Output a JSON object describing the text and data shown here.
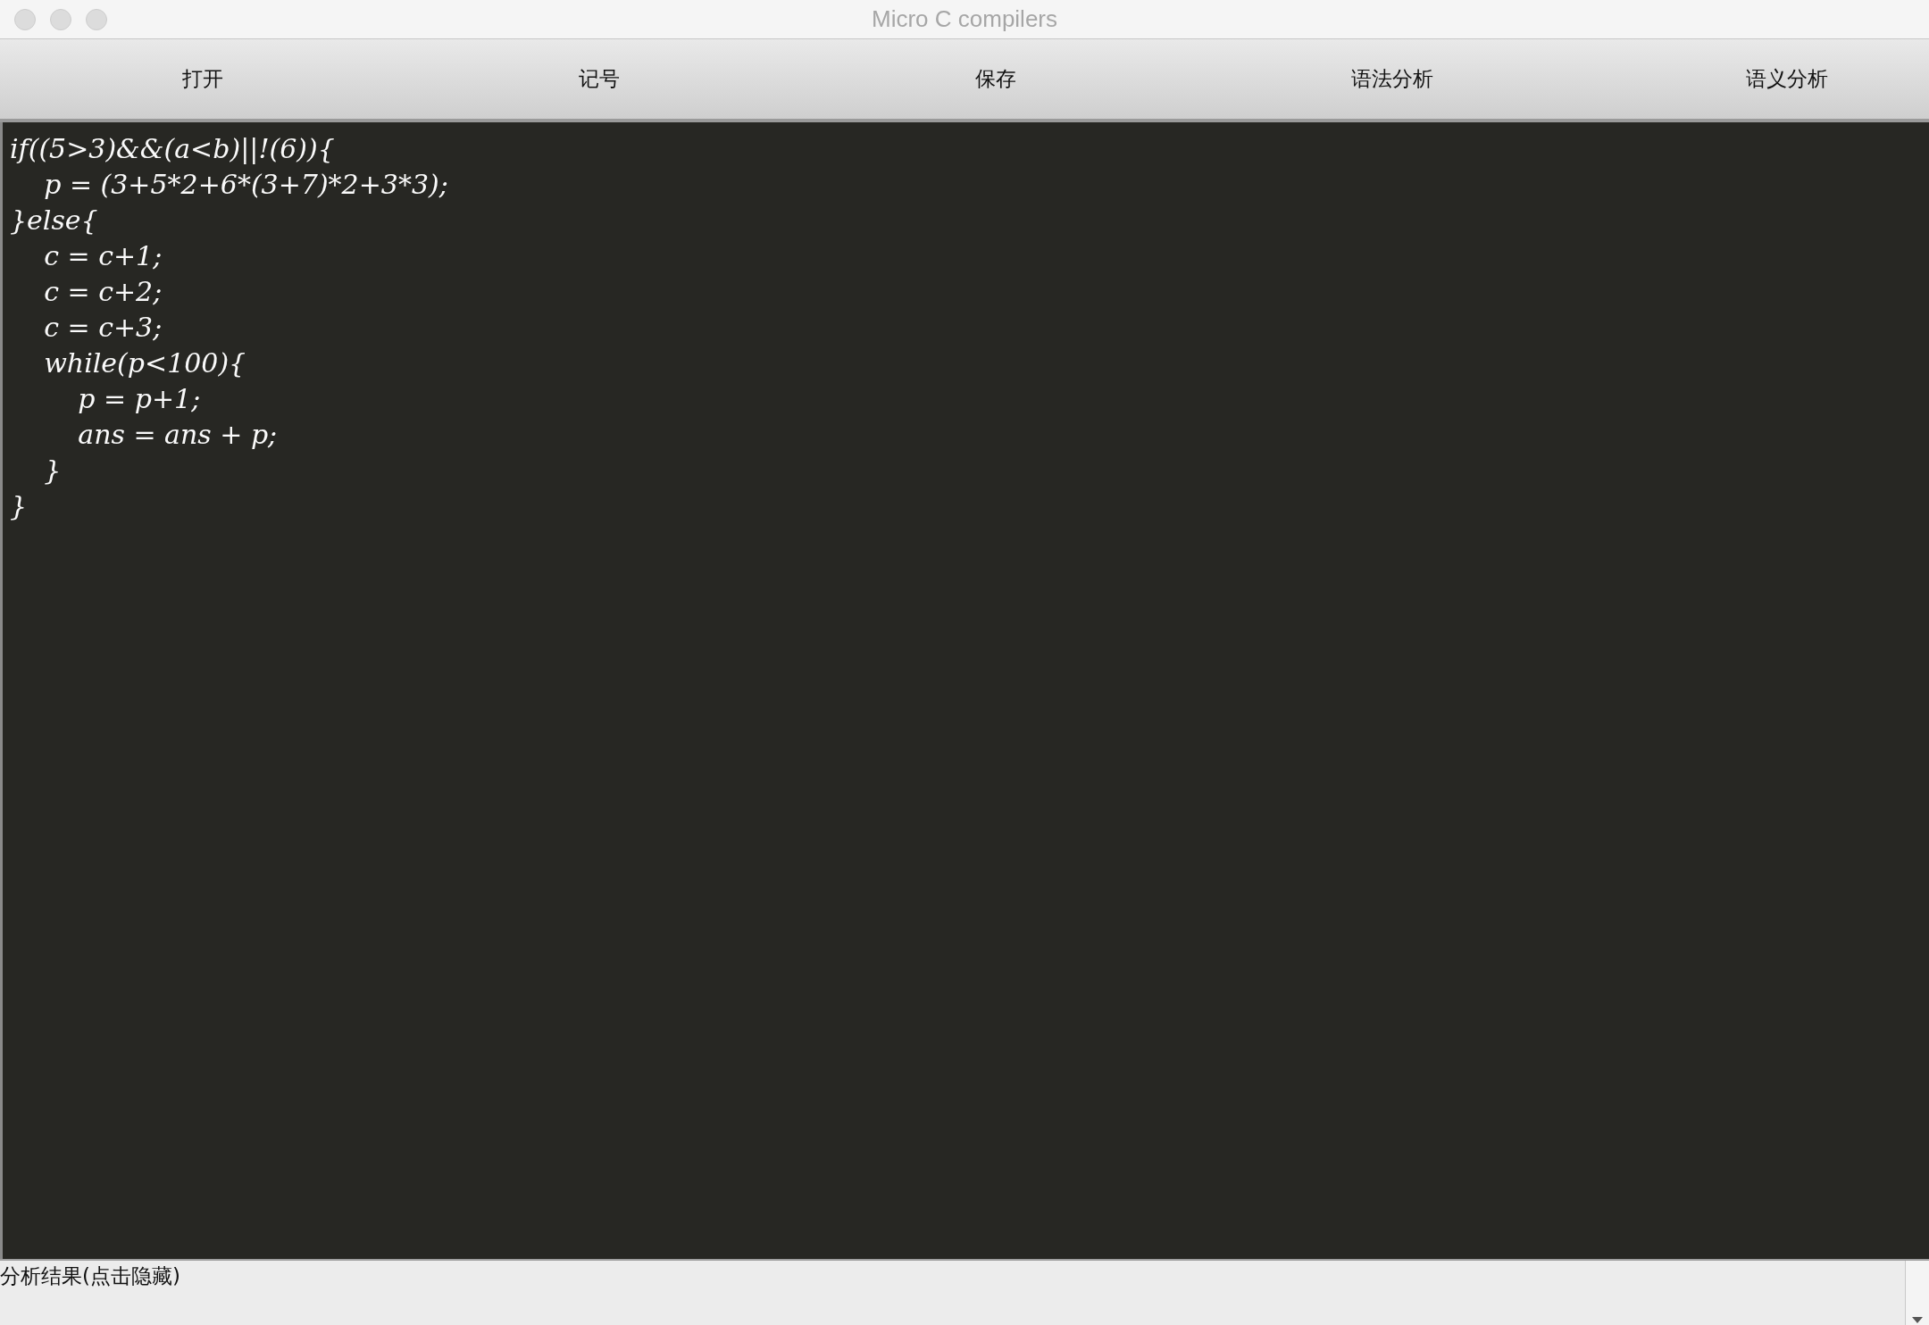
{
  "window": {
    "title": "Micro C compilers"
  },
  "toolbar": [
    "打开",
    "记号",
    "保存",
    "语法分析",
    "语义分析"
  ],
  "editor": {
    "lines": [
      "if((5>3)&&(a<b)||!(6)){",
      "    p = (3+5*2+6*(3+7)*2+3*3);",
      "}else{",
      "    c = c+1;",
      "    c = c+2;",
      "    c = c+3;",
      "    while(p<100){",
      "        p = p+1;",
      "        ans = ans + p;",
      "    }",
      "}"
    ]
  },
  "result_panel": {
    "label": "分析结果(点击隐藏)"
  }
}
